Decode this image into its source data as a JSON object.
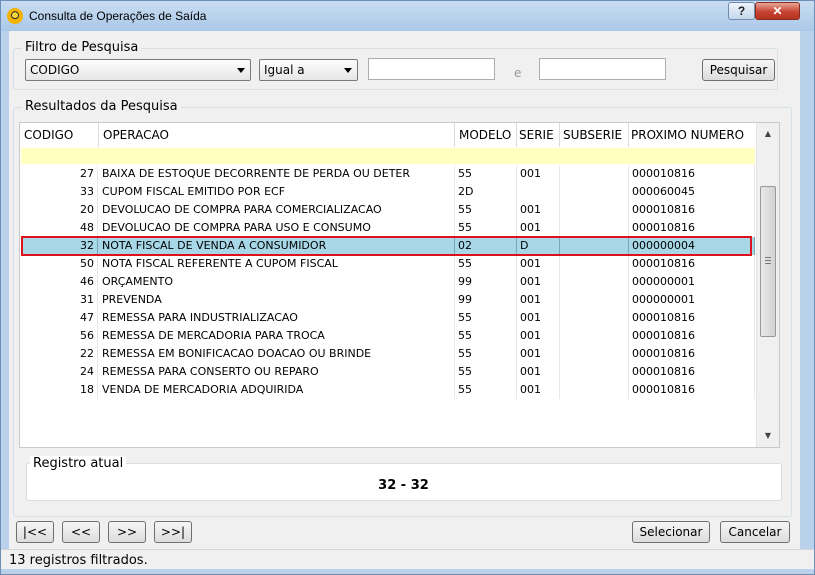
{
  "window": {
    "title": "Consulta de Operações de Saída",
    "help_label": "?",
    "close_label": "✕"
  },
  "filter": {
    "group_title": "Filtro de Pesquisa",
    "field_value": "CODIGO",
    "operator_value": "Igual a",
    "value1": "",
    "and_label": "e",
    "value2": "",
    "search_label": "Pesquisar"
  },
  "results": {
    "group_title": "Resultados da Pesquisa",
    "columns": [
      "CODIGO",
      "OPERACAO",
      "MODELO",
      "SERIE",
      "SUBSERIE",
      "PROXIMO NUMERO"
    ],
    "rows": [
      {
        "codigo": "27",
        "operacao": "BAIXA DE ESTOQUE DECORRENTE DE PERDA OU DETER",
        "modelo": "55",
        "serie": "001",
        "subserie": "",
        "proximo": "000010816"
      },
      {
        "codigo": "33",
        "operacao": "CUPOM FISCAL EMITIDO POR ECF",
        "modelo": "2D",
        "serie": "",
        "subserie": "",
        "proximo": "000060045"
      },
      {
        "codigo": "20",
        "operacao": "DEVOLUCAO DE COMPRA PARA COMERCIALIZACAO",
        "modelo": "55",
        "serie": "001",
        "subserie": "",
        "proximo": "000010816"
      },
      {
        "codigo": "48",
        "operacao": "DEVOLUCAO DE COMPRA PARA USO E CONSUMO",
        "modelo": "55",
        "serie": "001",
        "subserie": "",
        "proximo": "000010816"
      },
      {
        "codigo": "32",
        "operacao": "NOTA FISCAL DE VENDA A CONSUMIDOR",
        "modelo": "02",
        "serie": "D",
        "subserie": "",
        "proximo": "000000004"
      },
      {
        "codigo": "50",
        "operacao": "NOTA FISCAL REFERENTE A CUPOM FISCAL",
        "modelo": "55",
        "serie": "001",
        "subserie": "",
        "proximo": "000010816"
      },
      {
        "codigo": "46",
        "operacao": "ORÇAMENTO",
        "modelo": "99",
        "serie": "001",
        "subserie": "",
        "proximo": "000000001"
      },
      {
        "codigo": "31",
        "operacao": "PREVENDA",
        "modelo": "99",
        "serie": "001",
        "subserie": "",
        "proximo": "000000001"
      },
      {
        "codigo": "47",
        "operacao": "REMESSA  PARA INDUSTRIALIZACAO",
        "modelo": "55",
        "serie": "001",
        "subserie": "",
        "proximo": "000010816"
      },
      {
        "codigo": "56",
        "operacao": "REMESSA DE MERCADORIA PARA TROCA",
        "modelo": "55",
        "serie": "001",
        "subserie": "",
        "proximo": "000010816"
      },
      {
        "codigo": "22",
        "operacao": "REMESSA EM BONIFICACAO  DOACAO OU BRINDE",
        "modelo": "55",
        "serie": "001",
        "subserie": "",
        "proximo": "000010816"
      },
      {
        "codigo": "24",
        "operacao": "REMESSA PARA CONSERTO OU REPARO",
        "modelo": "55",
        "serie": "001",
        "subserie": "",
        "proximo": "000010816"
      },
      {
        "codigo": "18",
        "operacao": "VENDA DE MERCADORIA ADQUIRIDA",
        "modelo": "55",
        "serie": "001",
        "subserie": "",
        "proximo": "000010816"
      }
    ],
    "selected_row": 4
  },
  "registro": {
    "group_title": "Registro atual",
    "value": "32 - 32"
  },
  "navigation": {
    "first": "|<<",
    "prev": "<<",
    "next": ">>",
    "last": ">>|"
  },
  "actions": {
    "select": "Selecionar",
    "cancel": "Cancelar"
  },
  "status": {
    "text": "13 registros filtrados."
  },
  "colors": {
    "selected_row": "#a8d8e8",
    "filter_row": "#ffffc0",
    "highlight_border": "#e0101a"
  }
}
